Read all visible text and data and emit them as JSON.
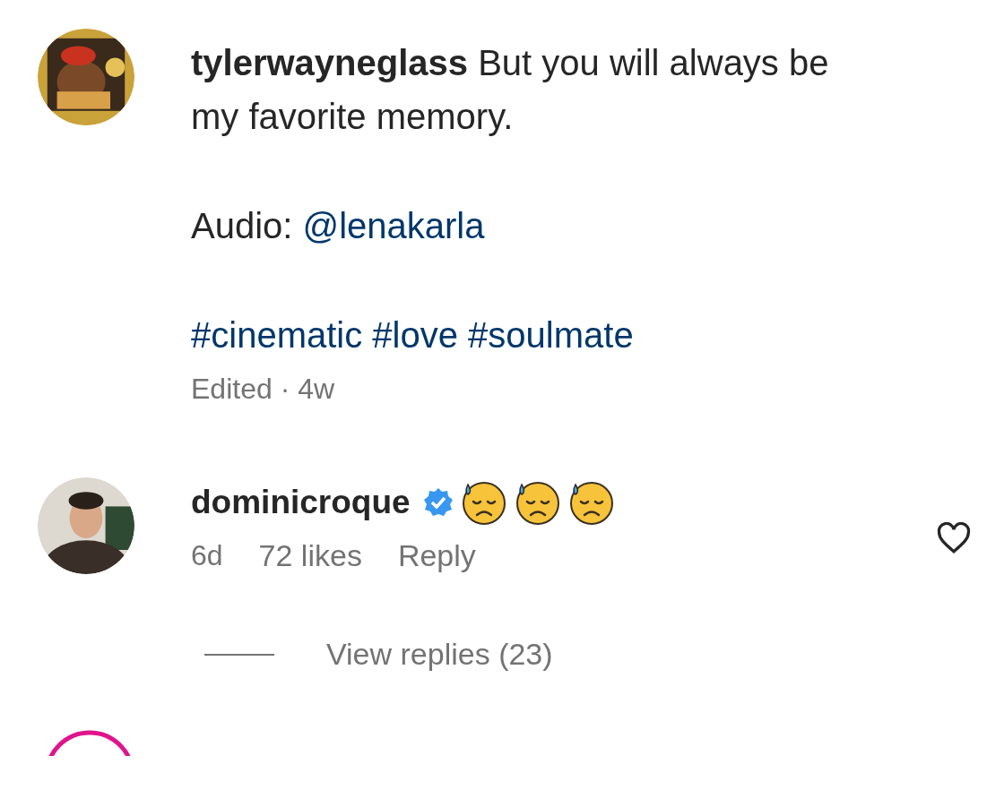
{
  "caption": {
    "username": "tylerwayneglass",
    "text": "But you will always be my favorite memory.",
    "audio": {
      "label": "Audio:",
      "mention": "@lenakarla"
    },
    "hashtags": [
      "#cinematic",
      "#love",
      "#soulmate"
    ],
    "timestamp": "Edited · 4w"
  },
  "comments": [
    {
      "username": "dominicroque",
      "verified": true,
      "liked": false,
      "age": "6d",
      "likes": "72 likes",
      "reply_label": "Reply",
      "view_replies": "View replies (23)"
    }
  ]
}
